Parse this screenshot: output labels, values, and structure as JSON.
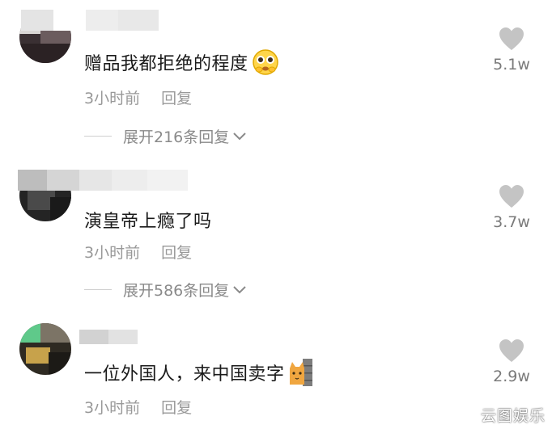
{
  "comments": [
    {
      "text": "赠品我都拒绝的程度",
      "emoji": "pleading-face-emoji",
      "time": "3小时前",
      "reply_label": "回复",
      "expand_label": "展开216条回复",
      "likes": "5.1w"
    },
    {
      "text": "演皇帝上瘾了吗",
      "time": "3小时前",
      "reply_label": "回复",
      "expand_label": "展开586条回复",
      "likes": "3.7w"
    },
    {
      "text": "一位外国人，来中国卖字",
      "emoji": "cat-peeking-wall-emoji",
      "time": "3小时前",
      "reply_label": "回复",
      "likes": "2.9w"
    }
  ],
  "watermark": "云图娱乐",
  "icons": {
    "like": "heart-icon",
    "expand": "chevron-down-icon"
  },
  "colors": {
    "text": "#1a1a1a",
    "meta": "#999999",
    "heart": "#c4c4c4"
  }
}
